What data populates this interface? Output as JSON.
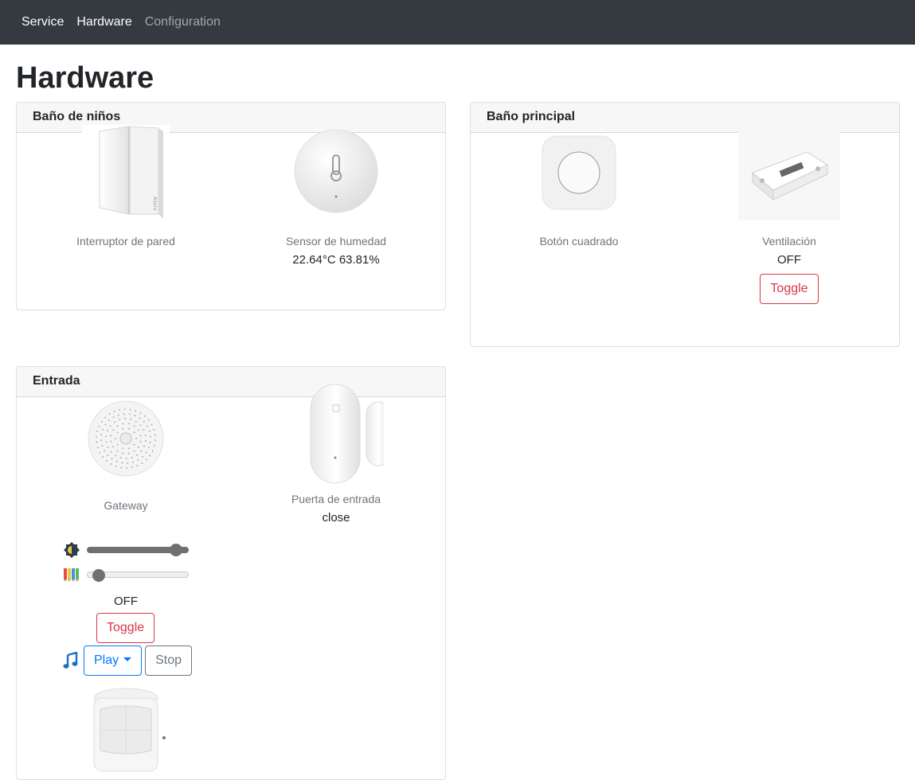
{
  "nav": {
    "items": [
      {
        "label": "Service"
      },
      {
        "label": "Hardware"
      },
      {
        "label": "Configuration"
      }
    ]
  },
  "page": {
    "title": "Hardware"
  },
  "cards": {
    "banio_ninos": {
      "title": "Baño de niños",
      "switch": {
        "name": "Interruptor de pared",
        "icon": "wall-switch-icon"
      },
      "sensor": {
        "name": "Sensor de humedad",
        "value": "22.64°C 63.81%",
        "icon": "humidity-sensor-icon"
      }
    },
    "banio_principal": {
      "title": "Baño principal",
      "button": {
        "name": "Botón cuadrado",
        "icon": "square-button-icon"
      },
      "ventilation": {
        "name": "Ventilación",
        "state": "OFF",
        "toggle_label": "Toggle",
        "icon": "relay-switch-icon"
      }
    },
    "entrada": {
      "title": "Entrada",
      "gateway": {
        "name": "Gateway",
        "icon": "gateway-icon",
        "brightness": 0.93,
        "color": 0.05,
        "state": "OFF",
        "toggle_label": "Toggle",
        "play_label": "Play",
        "stop_label": "Stop"
      },
      "door": {
        "name": "Puerta de entrada",
        "state": "close",
        "icon": "door-sensor-icon"
      },
      "motion": {
        "icon": "motion-sensor-icon"
      }
    }
  },
  "colors": {
    "navbar": "#343a40",
    "danger": "#dc3545",
    "primary": "#007bff",
    "secondary": "#6c757d"
  }
}
